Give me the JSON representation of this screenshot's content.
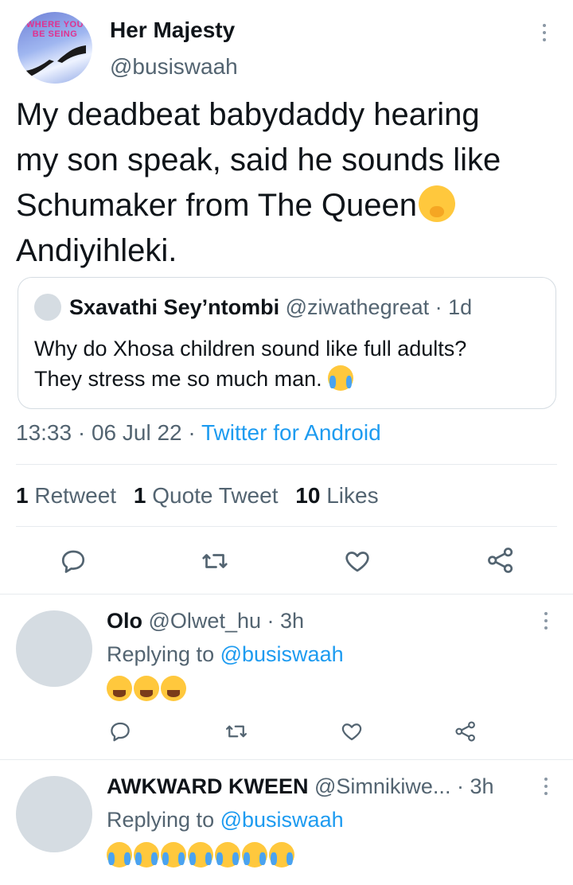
{
  "tweet": {
    "display_name": "Her Majesty",
    "handle": "@busiswaah",
    "avatar_text": "WHERE YOU BE SEING",
    "text_lines": [
      "My deadbeat babydaddy hearing",
      "my son speak, said he sounds like",
      "Schumaker from The Queen",
      "Andiyihleki."
    ],
    "emoji_after_line3": "yawning-face-emoji",
    "quote": {
      "name": "Sxavathi Sey’ntombi",
      "handle": "@ziwathegreat",
      "time": "· 1d",
      "line1": "Why do Xhosa children sound like full adults?",
      "line2": "They stress me so much man.",
      "emoji": "loudly-crying-face-emoji"
    },
    "time": "13:33",
    "sep1": "·",
    "date": "06 Jul 22",
    "sep2": "·",
    "source": "Twitter for Android",
    "stats": {
      "retweets_count": "1",
      "retweets_label": "Retweet",
      "quotes_count": "1",
      "quotes_label": "Quote Tweet",
      "likes_count": "10",
      "likes_label": "Likes"
    },
    "actions": [
      "reply-icon",
      "retweet-icon",
      "like-icon",
      "share-icon"
    ]
  },
  "replies": [
    {
      "name": "Olo",
      "handle": "@Olwet_hu",
      "time": "· 3h",
      "replying_prefix": "Replying to",
      "replying_to": "@busiswaah",
      "emojis": [
        "face-with-tears-of-joy",
        "face-with-tears-of-joy",
        "face-with-tears-of-joy"
      ]
    },
    {
      "name": "AWKWARD KWEEN",
      "handle": "@Simnikiwe...",
      "time": "· 3h",
      "replying_prefix": "Replying to",
      "replying_to": "@busiswaah",
      "emojis": [
        "loudly-crying-face",
        "loudly-crying-face",
        "loudly-crying-face",
        "loudly-crying-face",
        "loudly-crying-face",
        "loudly-crying-face",
        "loudly-crying-face"
      ]
    }
  ],
  "colors": {
    "accent": "#1d9bf0",
    "text": "#0f1419",
    "muted": "#536471",
    "divider": "#e7ebee"
  }
}
